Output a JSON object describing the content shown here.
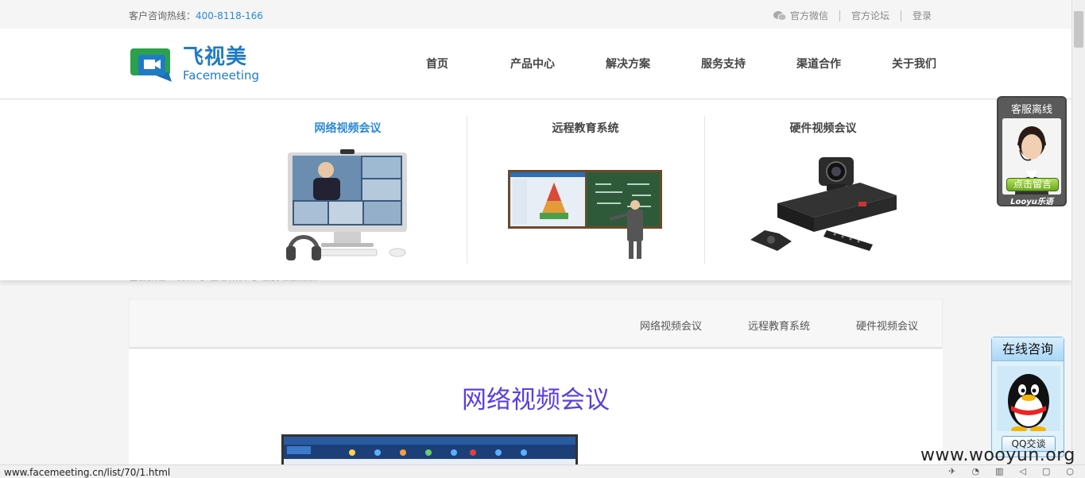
{
  "topbar": {
    "hotline_label": "客户咨询热线：",
    "hotline_number": "400-8118-166",
    "links": [
      "官方微信",
      "官方论坛",
      "登录"
    ]
  },
  "logo": {
    "cn": "飞视美",
    "en": "Facemeeting"
  },
  "nav": [
    "首页",
    "产品中心",
    "解决方案",
    "服务支持",
    "渠道合作",
    "关于我们"
  ],
  "dropdown": [
    {
      "title": "网络视频会议",
      "active": true
    },
    {
      "title": "远程教育系统",
      "active": false
    },
    {
      "title": "硬件视频会议",
      "active": false
    }
  ],
  "breadcrumb_ghost": "当前位置：首页 > 产品中心 > 网络视频会议",
  "subnav": [
    "网络视频会议",
    "远程教育系统",
    "硬件视频会议"
  ],
  "content": {
    "title": "网络视频会议"
  },
  "service_widget": {
    "title": "客服离线",
    "button": "点击留言",
    "brand": "Looyu乐语"
  },
  "qq_widget": {
    "title": "在线咨询",
    "button": "QQ交谈"
  },
  "statusbar": {
    "url": "www.facemeeting.cn/list/70/1.html"
  },
  "watermark": "www.wooyun.org",
  "colors": {
    "accent": "#2b89d6",
    "title_purple": "#5b3ee0"
  }
}
